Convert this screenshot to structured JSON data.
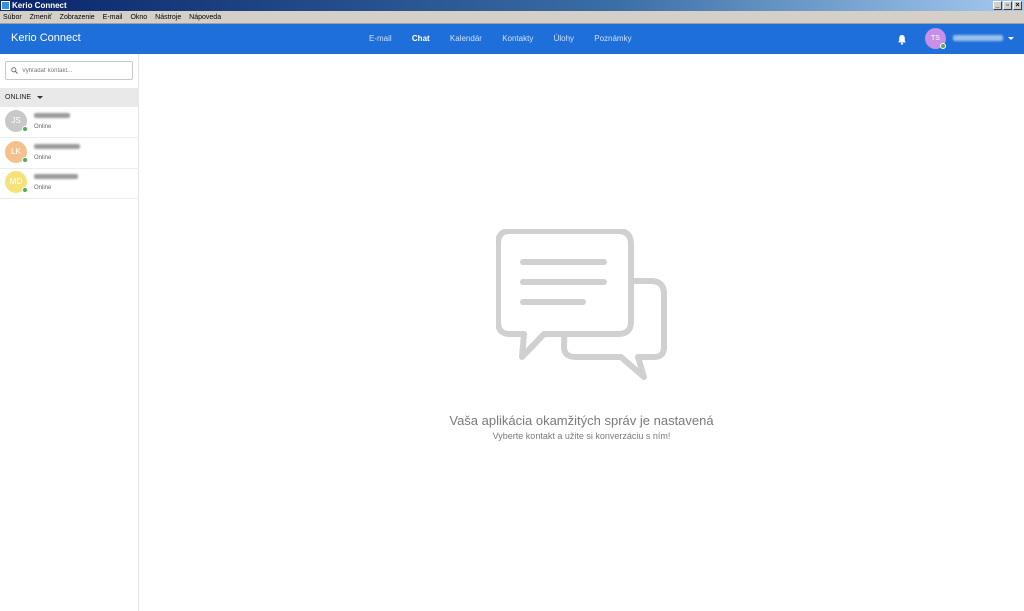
{
  "window": {
    "title": "Kerio Connect"
  },
  "menubar": {
    "items": [
      "Súbor",
      "Zmeniť",
      "Zobrazenie",
      "E-mail",
      "Okno",
      "Nástroje",
      "Nápoveda"
    ]
  },
  "header": {
    "brand": "Kerio Connect",
    "nav": [
      "E-mail",
      "Chat",
      "Kalendár",
      "Kontakty",
      "Úlohy",
      "Poznámky"
    ],
    "active_nav": "Chat",
    "user_initials": "TS"
  },
  "sidebar": {
    "search_placeholder": "Vyhľadať kontakt...",
    "group_label": "ONLINE",
    "contacts": [
      {
        "initials": "JS",
        "status": "Online",
        "color": "#c8c8c8"
      },
      {
        "initials": "LK",
        "status": "Online",
        "color": "#f5c08c"
      },
      {
        "initials": "MD",
        "status": "Online",
        "color": "#f7e27a"
      }
    ]
  },
  "main": {
    "headline": "Vaša aplikácia okamžitých správ je nastavená",
    "subline": "Vyberte kontakt a užite si konverzáciu s ním!"
  },
  "colors": {
    "accent": "#1e6fd9",
    "online": "#4cae4c"
  }
}
